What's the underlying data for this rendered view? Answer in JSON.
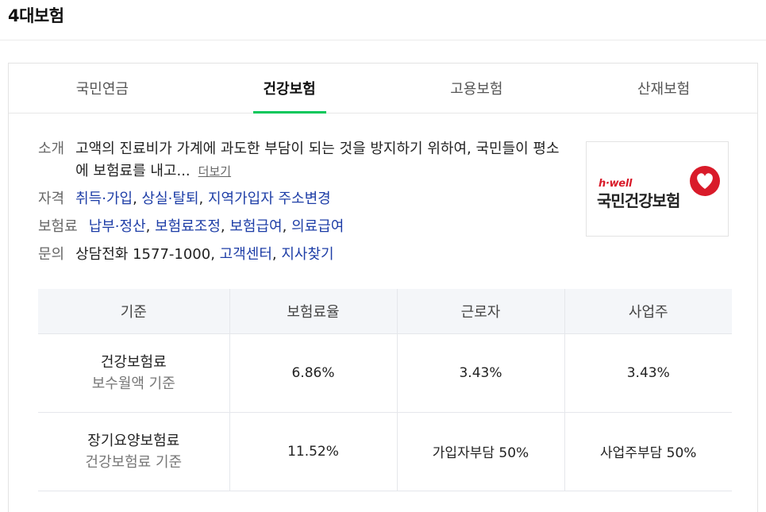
{
  "header": {
    "title": "4대보험"
  },
  "tabs": [
    {
      "label": "국민연금",
      "active": false
    },
    {
      "label": "건강보험",
      "active": true
    },
    {
      "label": "고용보험",
      "active": false
    },
    {
      "label": "산재보험",
      "active": false
    }
  ],
  "info": {
    "intro": {
      "label": "소개",
      "text": "고액의 진료비가 가계에 과도한 부담이 되는 것을 방지하기 위하여, 국민들이 평소에 보험료를 내고...",
      "more": "더보기"
    },
    "qualification": {
      "label": "자격",
      "links": [
        "취득·가입",
        "상실·탈퇴",
        "지역가입자 주소변경"
      ]
    },
    "premium": {
      "label": "보험료",
      "links": [
        "납부·정산",
        "보험료조정",
        "보험급여",
        "의료급여"
      ]
    },
    "inquiry": {
      "label": "문의",
      "phone": "상담전화 1577-1000",
      "links": [
        "고객센터",
        "지사찾기"
      ]
    }
  },
  "logo": {
    "text_en": "h·well",
    "text_ko": "국민건강보험",
    "brand_color": "#d91b2a",
    "icon": "heart-logo-icon"
  },
  "table": {
    "headers": [
      "기준",
      "보험료율",
      "근로자",
      "사업주"
    ],
    "rows": [
      {
        "name": "건강보험료",
        "sub": "보수월액 기준",
        "rate": "6.86%",
        "employee": "3.43%",
        "employer": "3.43%"
      },
      {
        "name": "장기요양보험료",
        "sub": "건강보험료 기준",
        "rate": "11.52%",
        "employee": "가입자부담 50%",
        "employer": "사업주부담 50%"
      }
    ]
  },
  "colors": {
    "accent": "#03c75a",
    "link": "#1e3ea7",
    "header_bg": "#f4f6f9"
  }
}
